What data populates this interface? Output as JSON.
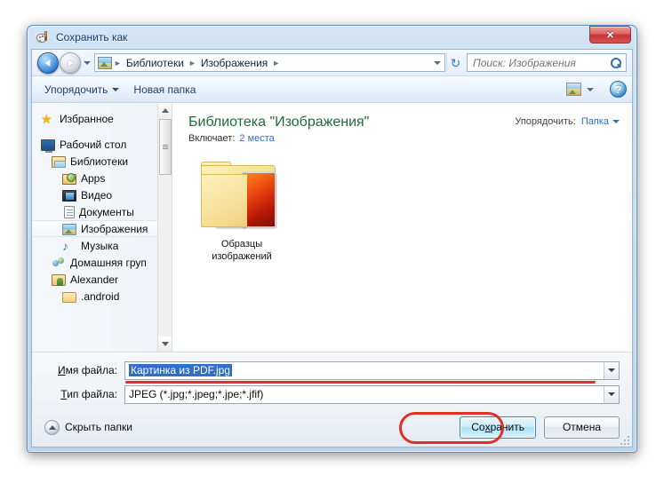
{
  "window": {
    "title": "Сохранить как",
    "app_icon": "paint-icon",
    "close_label": "✕"
  },
  "address_bar": {
    "back_label": "Назад",
    "forward_label": "Вперед",
    "history_label": "История",
    "crumbs": [
      "Библиотеки",
      "Изображения"
    ],
    "separator": "►",
    "dropdown_label": "▾",
    "refresh_label": "↻",
    "search_placeholder": "Поиск: Изображения",
    "search_value": ""
  },
  "command_bar": {
    "organize_label": "Упорядочить",
    "new_folder_label": "Новая папка",
    "view_icon": "view-layout-icon",
    "help_label": "?"
  },
  "sidebar": {
    "items": [
      {
        "label": "Избранное",
        "icon": "star-icon",
        "indent": 0,
        "selected": false
      },
      {
        "label": "Рабочий стол",
        "icon": "desktop-icon",
        "indent": 0,
        "selected": false
      },
      {
        "label": "Библиотеки",
        "icon": "library-icon",
        "indent": 1,
        "selected": false
      },
      {
        "label": "Apps",
        "icon": "apps-folder-icon",
        "indent": 2,
        "selected": false
      },
      {
        "label": "Видео",
        "icon": "video-library-icon",
        "indent": 2,
        "selected": false
      },
      {
        "label": "Документы",
        "icon": "documents-library-icon",
        "indent": 2,
        "selected": false
      },
      {
        "label": "Изображения",
        "icon": "pictures-library-icon",
        "indent": 2,
        "selected": true
      },
      {
        "label": "Музыка",
        "icon": "music-library-icon",
        "indent": 2,
        "selected": false
      },
      {
        "label": "Домашняя груп",
        "icon": "homegroup-icon",
        "indent": 1,
        "selected": false
      },
      {
        "label": "Alexander",
        "icon": "user-folder-icon",
        "indent": 1,
        "selected": false
      },
      {
        "label": ".android",
        "icon": "folder-icon",
        "indent": 2,
        "selected": false
      }
    ]
  },
  "content": {
    "library_title": "Библиотека \"Изображения\"",
    "includes_label": "Включает:",
    "includes_value": "2 места",
    "arrange_label": "Упорядочить:",
    "arrange_value": "Папка",
    "items": [
      {
        "name_line1": "Образцы",
        "name_line2": "изображений",
        "icon": "folder-with-pictures-icon"
      }
    ]
  },
  "form": {
    "filename_label_pre": "И",
    "filename_label_post": "мя файла:",
    "filename_value": "Картинка из PDF.jpg",
    "filetype_label_pre": "Т",
    "filetype_label_post": "ип файла:",
    "filetype_value": "JPEG (*.jpg;*.jpeg;*.jpe;*.jfif)"
  },
  "footer": {
    "hide_folders_label": "Скрыть папки",
    "save_label_pre": "Со",
    "save_label_mid": "х",
    "save_label_post": "ранить",
    "cancel_label": "Отмена"
  },
  "colors": {
    "accent_blue": "#2f6fc8",
    "library_green": "#1f6b3a",
    "annotation_red": "#e03127",
    "selection_blue": "#2f6fc8"
  }
}
